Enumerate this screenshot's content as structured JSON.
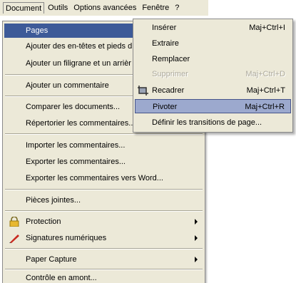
{
  "menubar": {
    "items": [
      "Document",
      "Outils",
      "Options avancées",
      "Fenêtre",
      "?"
    ]
  },
  "document_menu": {
    "items": [
      {
        "label": "Pages",
        "highlighted": true,
        "submenu": true
      },
      {
        "label": "Ajouter des en-têtes et pieds d"
      },
      {
        "label": "Ajouter un filigrane et un arrièr"
      },
      {
        "label": "Ajouter un commentaire"
      },
      {
        "label": "Comparer les documents..."
      },
      {
        "label": "Répertorier les commentaires..."
      },
      {
        "label": "Importer les commentaires..."
      },
      {
        "label": "Exporter les commentaires..."
      },
      {
        "label": "Exporter les commentaires vers Word..."
      },
      {
        "label": "Pièces jointes..."
      },
      {
        "label": "Protection",
        "icon": "lock-icon",
        "submenu": true
      },
      {
        "label": "Signatures numériques",
        "icon": "pen-icon",
        "submenu": true
      },
      {
        "label": "Paper Capture",
        "submenu": true
      },
      {
        "label": "Contrôle en amont..."
      }
    ]
  },
  "pages_submenu": {
    "items": [
      {
        "label": "Insérer",
        "shortcut": "Maj+Ctrl+I"
      },
      {
        "label": "Extraire",
        "shortcut": ""
      },
      {
        "label": "Remplacer",
        "shortcut": ""
      },
      {
        "label": "Supprimer",
        "shortcut": "Maj+Ctrl+D",
        "disabled": true
      },
      {
        "label": "Recadrer",
        "shortcut": "Maj+Ctrl+T",
        "icon": "crop-icon"
      },
      {
        "label": "Pivoter",
        "shortcut": "Maj+Ctrl+R",
        "highlighted": true
      },
      {
        "label": "Définir les transitions de page...",
        "shortcut": ""
      }
    ]
  },
  "colors": {
    "menu_bg": "#ECE9D8",
    "highlight_dark": "#3D5A98",
    "highlight_light": "#9CA9CE"
  }
}
